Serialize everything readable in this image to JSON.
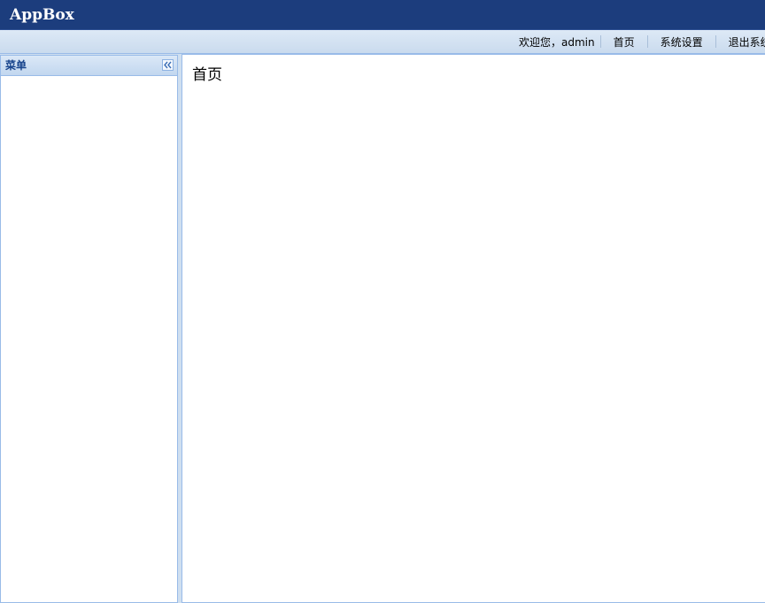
{
  "header": {
    "logo": "AppBox"
  },
  "topbar": {
    "welcome": "欢迎您，admin",
    "links": [
      "首页",
      "系统设置",
      "退出系统"
    ]
  },
  "left_panel": {
    "title": "菜单",
    "collapse_icon": "double-chevron-left-icon"
  },
  "main": {
    "title": "首页"
  },
  "colors": {
    "header_bg": "#1c3d7d",
    "panel_border": "#99bbe8",
    "panel_title": "#15428b"
  }
}
